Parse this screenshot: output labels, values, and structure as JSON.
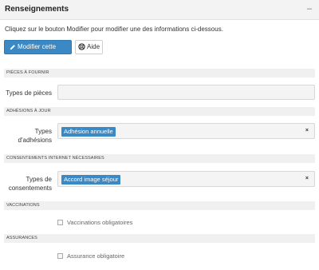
{
  "panel": {
    "title": "Renseignements",
    "collapse_symbol": "–",
    "collapse_icon": "minus-icon"
  },
  "intro_text": "Cliquez sur le bouton Modifier pour modifier une des informations ci-dessous.",
  "buttons": {
    "edit_label": "Modifier cette page",
    "edit_icon": "pencil-icon",
    "help_label": "Aide",
    "help_icon": "help-icon"
  },
  "colors": {
    "primary": "#3a88c4",
    "header_bg": "#f3f3f3",
    "section_bg": "#f0f0f0"
  },
  "sections": {
    "documents": {
      "title": "PIÈCES À FOURNIR",
      "field_label": "Types de pièces",
      "value": ""
    },
    "adhesions": {
      "title": "ADHÉSIONS À JOUR",
      "field_label_line1": "Types",
      "field_label_line2": "d'adhésions",
      "tag": "Adhésion annuelle",
      "clear_symbol": "×"
    },
    "consents": {
      "title": "CONSENTEMENTS INTERNET NÉCESSAIRES",
      "field_label_line1": "Types de",
      "field_label_line2": "consentements",
      "tag": "Accord image séjour",
      "clear_symbol": "×"
    },
    "vaccinations": {
      "title": "VACCINATIONS",
      "checkbox_label": "Vaccinations obligatoires",
      "checked": false
    },
    "insurance": {
      "title": "ASSURANCES",
      "checkbox_label": "Assurance obligatoire",
      "checked": false
    }
  }
}
